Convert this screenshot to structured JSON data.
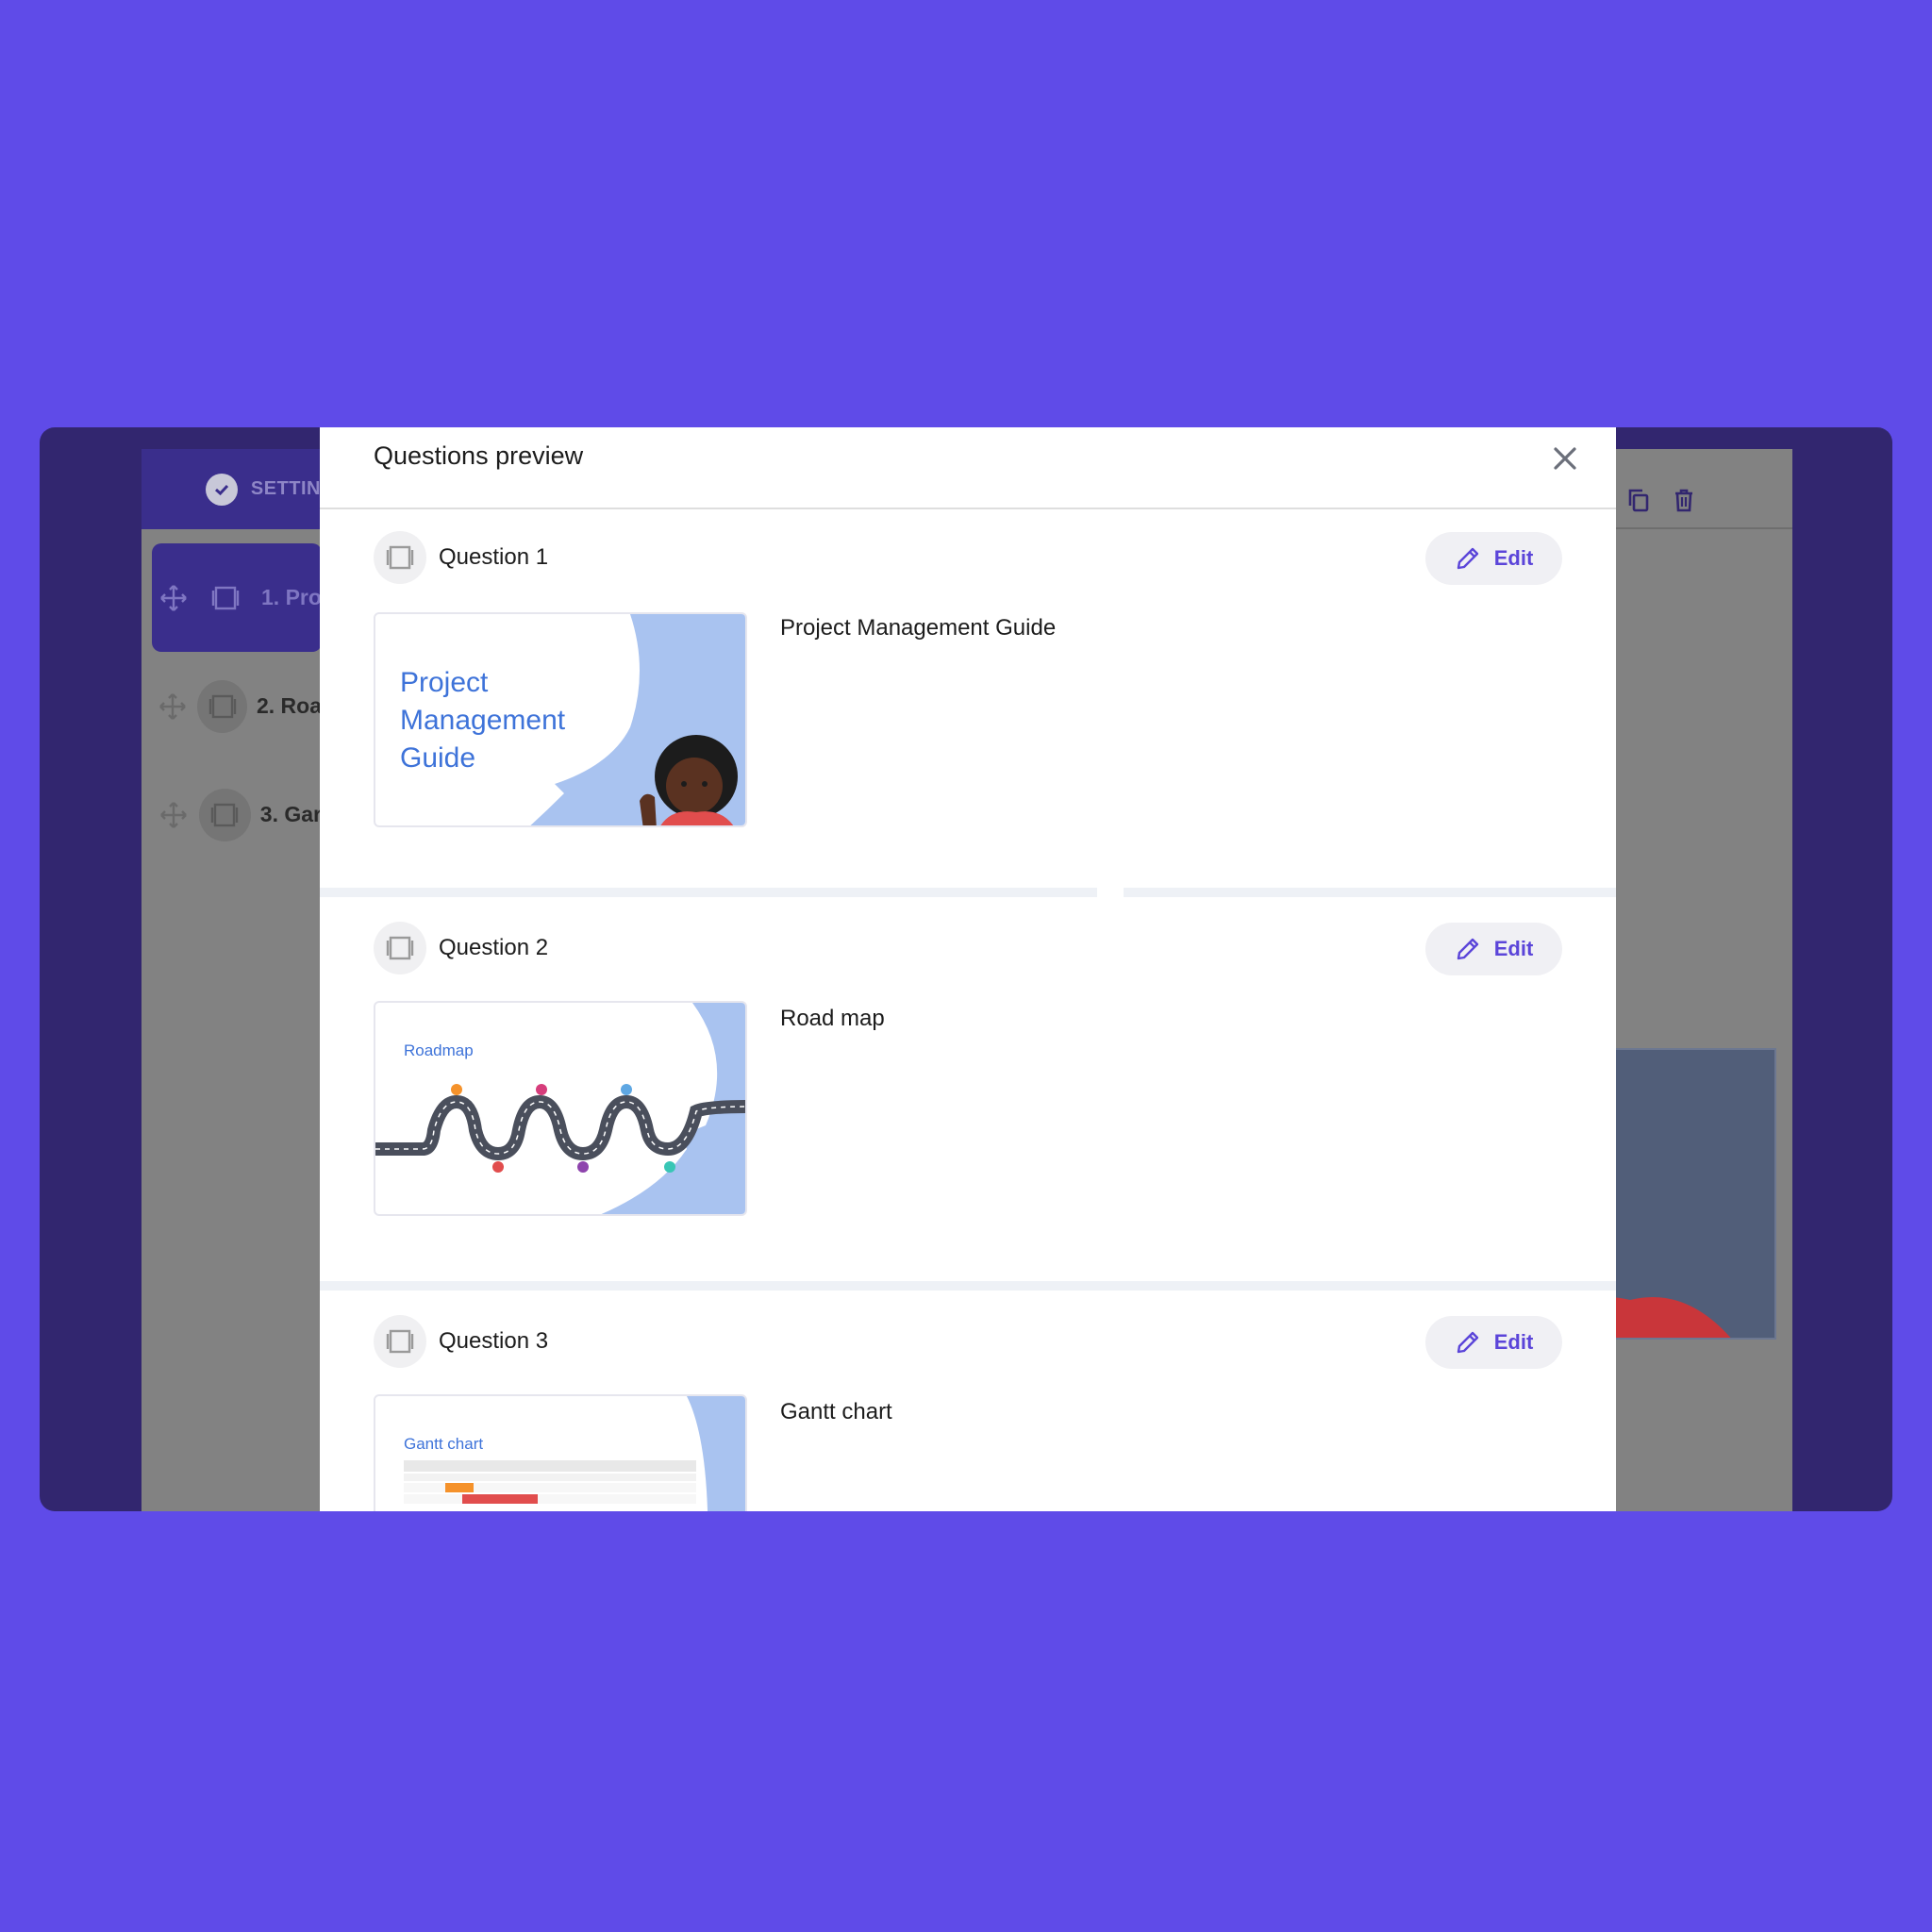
{
  "background_app": {
    "settings_tab_label": "SETTIN",
    "slides": [
      {
        "label": "1. Pro"
      },
      {
        "label": "2. Roa"
      },
      {
        "label": "3. Gar"
      }
    ]
  },
  "modal": {
    "title": "Questions preview",
    "questions": [
      {
        "label": "Question 1",
        "title": "Project Management Guide",
        "edit_label": "Edit",
        "thumb_text": [
          "Project",
          "Management",
          "Guide"
        ]
      },
      {
        "label": "Question 2",
        "title": "Road map",
        "edit_label": "Edit",
        "thumb_text": [
          "Roadmap"
        ]
      },
      {
        "label": "Question 3",
        "title": "Gantt chart",
        "edit_label": "Edit",
        "thumb_text": [
          "Gantt chart"
        ]
      }
    ]
  },
  "colors": {
    "page_background": "#5f4be8",
    "accent": "#5b45d9",
    "thumb_blue": "#a9c3f0"
  }
}
